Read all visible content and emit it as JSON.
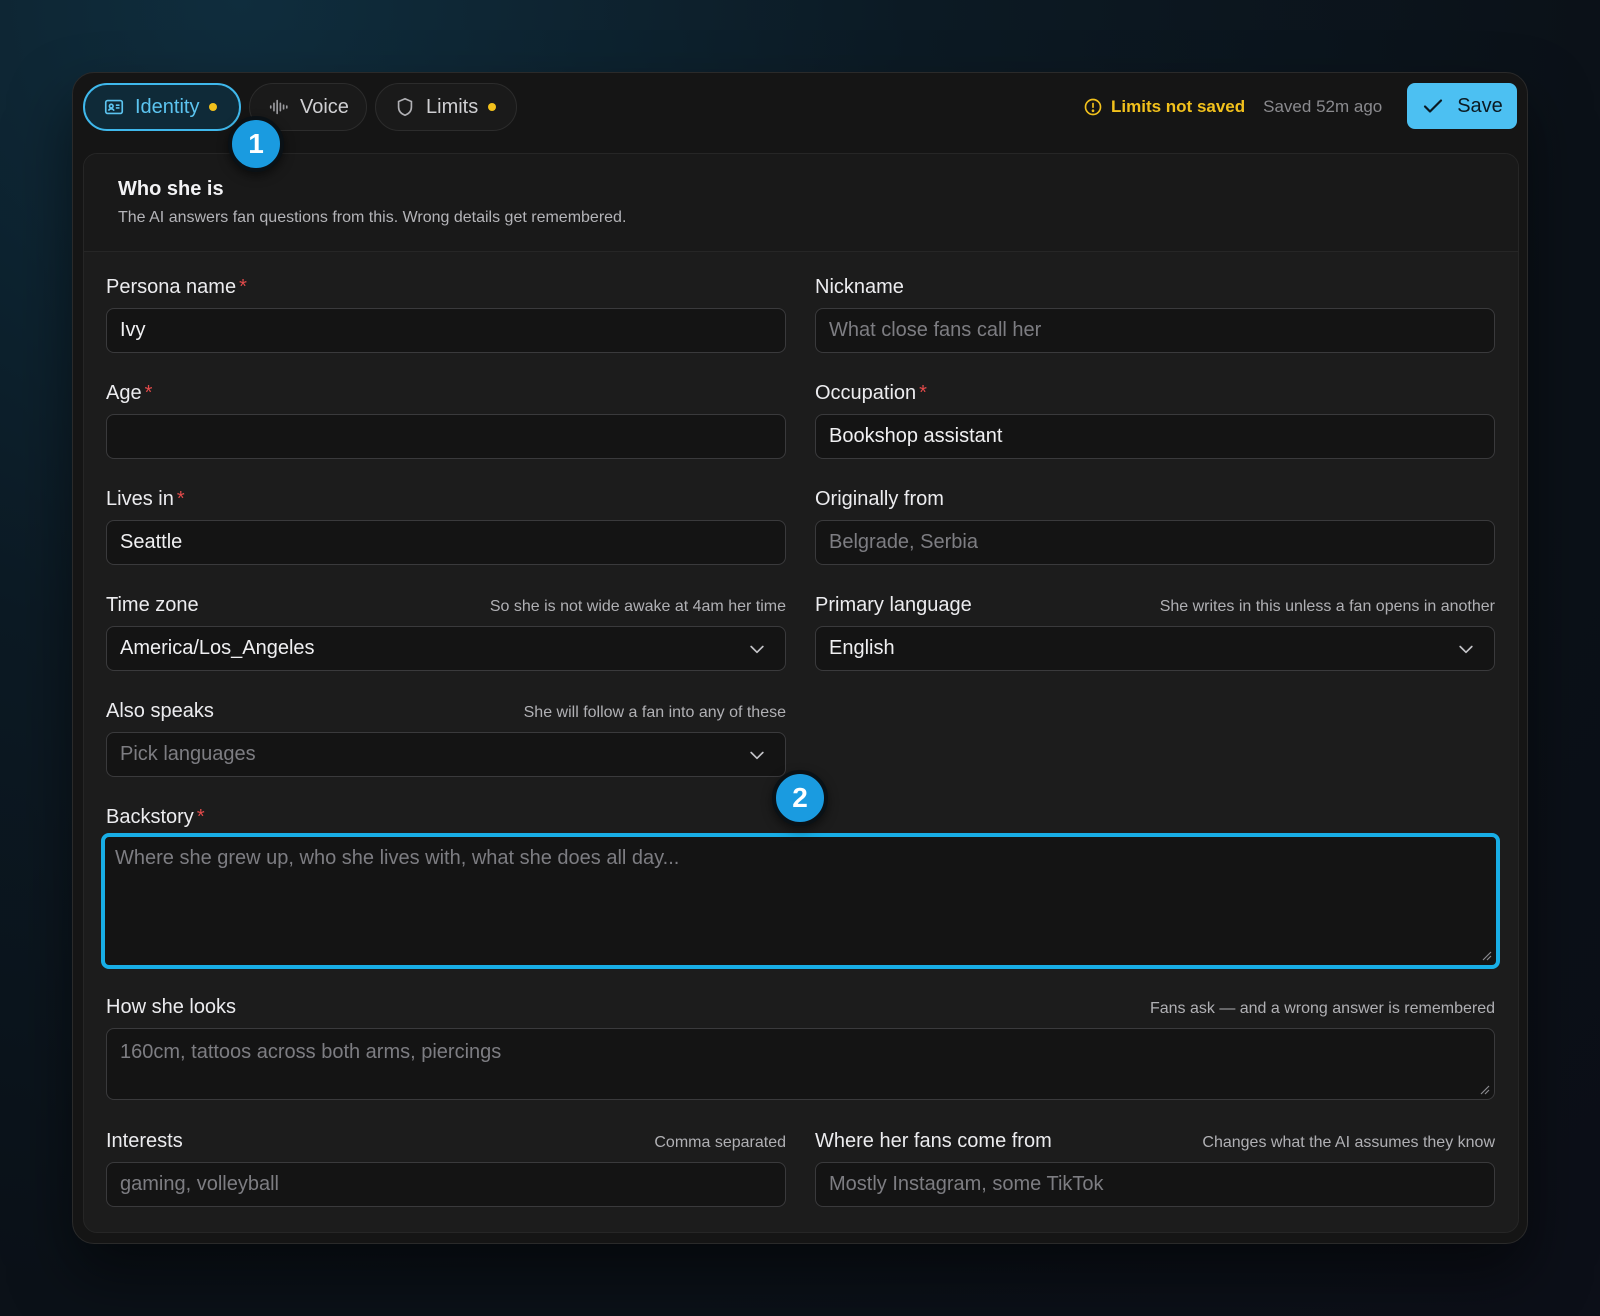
{
  "tabs": [
    {
      "label": "Identity",
      "icon": "id-card-icon",
      "unsaved": true,
      "active": true
    },
    {
      "label": "Voice",
      "icon": "waveform-icon",
      "unsaved": false,
      "active": false
    },
    {
      "label": "Limits",
      "icon": "shield-icon",
      "unsaved": true,
      "active": false
    }
  ],
  "status": {
    "warning": "Limits not saved",
    "saved": "Saved 52m ago",
    "save_label": "Save"
  },
  "section": {
    "title": "Who she is",
    "subtitle": "The AI answers fan questions from this. Wrong details get remembered."
  },
  "fields": {
    "persona_name": {
      "label": "Persona name",
      "value": "Ivy"
    },
    "nickname": {
      "label": "Nickname",
      "placeholder": "What close fans call her"
    },
    "age": {
      "label": "Age",
      "value": ""
    },
    "occupation": {
      "label": "Occupation",
      "value": "Bookshop assistant"
    },
    "lives_in": {
      "label": "Lives in",
      "value": "Seattle"
    },
    "originally_from": {
      "label": "Originally from",
      "placeholder": "Belgrade, Serbia"
    },
    "time_zone": {
      "label": "Time zone",
      "hint": "So she is not wide awake at 4am her time",
      "value": "America/Los_Angeles"
    },
    "primary_language": {
      "label": "Primary language",
      "hint": "She writes in this unless a fan opens in another",
      "value": "English"
    },
    "also_speaks": {
      "label": "Also speaks",
      "hint": "She will follow a fan into any of these",
      "placeholder": "Pick languages"
    },
    "backstory": {
      "label": "Backstory",
      "placeholder": "Where she grew up, who she lives with, what she does all day..."
    },
    "looks": {
      "label": "How she looks",
      "hint": "Fans ask — and a wrong answer is remembered",
      "placeholder": "160cm, tattoos across both arms, piercings"
    },
    "interests": {
      "label": "Interests",
      "hint": "Comma separated",
      "placeholder": "gaming, volleyball"
    },
    "fans_from": {
      "label": "Where her fans come from",
      "hint": "Changes what the AI assumes they know",
      "placeholder": "Mostly Instagram, some TikTok"
    }
  },
  "badges": [
    "1",
    "2"
  ],
  "colors": {
    "accent": "#4cc0f2",
    "warning": "#f2c11c",
    "required": "#e24a4a",
    "focus": "#18aee6"
  }
}
